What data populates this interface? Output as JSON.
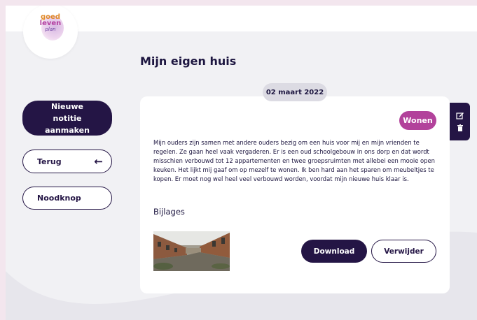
{
  "logo": {
    "line1": "goed",
    "line2": "leven",
    "line3": "plan"
  },
  "page": {
    "title": "Mijn eigen huis"
  },
  "sidebar": {
    "new_note_label": "Nieuwe notitie aanmaken",
    "back_label": "Terug",
    "emergency_label": "Noodknop"
  },
  "note": {
    "date": "02 maart 2022",
    "tag": "Wonen",
    "text": "Mijn ouders zijn samen met andere ouders bezig om een huis voor mij en mijn vrienden te regelen. Ze gaan heel vaak vergaderen. Er is een oud schoolgebouw in ons dorp en dat wordt misschien verbouwd tot 12 appartementen en twee groepsruimten met allebei een mooie open keuken. Het lijkt mij gaaf om op mezelf te wonen. Ik ben hard aan het sparen om meubeltjes te kopen. Er moet nog wel heel veel verbouwd worden, voordat mijn nieuwe huis klaar is.",
    "attachments_title": "Bijlages",
    "download_label": "Download",
    "delete_label": "Verwijder"
  },
  "icons": {
    "back": "arrow-left-icon",
    "edit": "edit-icon",
    "delete": "trash-icon"
  },
  "colors": {
    "primary": "#241545",
    "tag": "#b2429b",
    "background": "#f1f1f4"
  }
}
